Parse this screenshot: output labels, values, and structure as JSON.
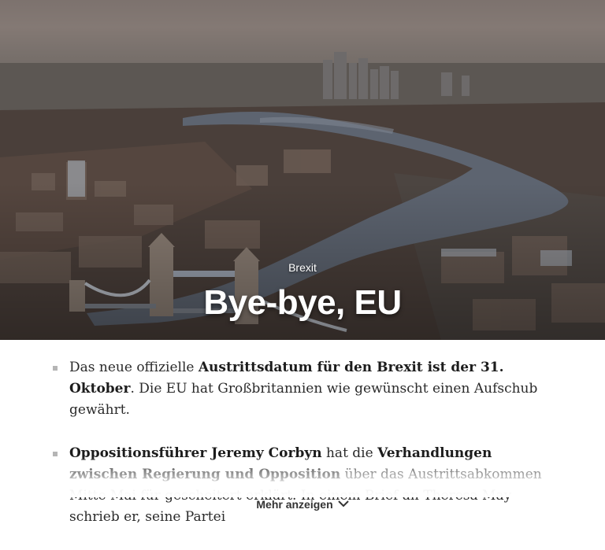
{
  "hero": {
    "kicker": "Brexit",
    "headline": "Bye-bye, EU",
    "image_description_icon": "london-aerial-photo"
  },
  "summary": {
    "items": [
      {
        "parts": [
          {
            "text": "Das neue offizielle ",
            "bold": false
          },
          {
            "text": "Austrittsdatum für den Brexit ist der 31. Oktober",
            "bold": true
          },
          {
            "text": ". Die EU hat Großbritannien wie gewünscht einen Aufschub gewährt.",
            "bold": false
          }
        ]
      },
      {
        "parts": [
          {
            "text": "Oppositionsführer Jeremy Corbyn",
            "bold": true
          },
          {
            "text": " hat die ",
            "bold": false
          },
          {
            "text": "Verhandlungen zwischen Regierung und Opposition",
            "bold": true
          },
          {
            "text": " über das Austrittsabkommen Mitte Mai für gescheitert erklärt. In einem Brief an Theresa May schrieb er, seine Partei",
            "bold": false
          }
        ]
      }
    ]
  },
  "more_button": {
    "label": "Mehr anzeigen",
    "icon": "chevron-down-icon"
  },
  "colors": {
    "bullet": "#b5b5b5",
    "river": "#5d6470",
    "text": "#2a2a2a"
  }
}
